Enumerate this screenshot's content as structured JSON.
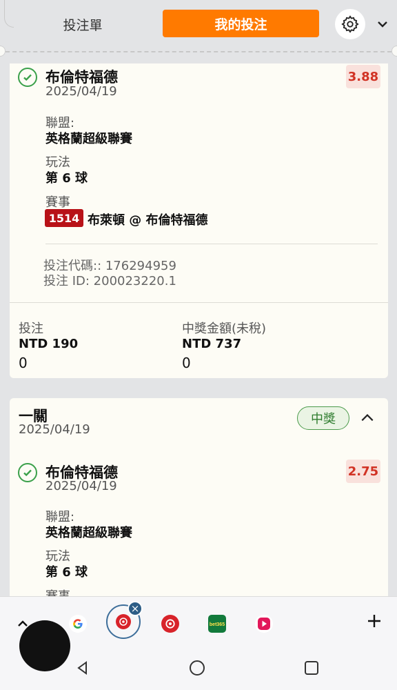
{
  "header": {
    "tab_betslip": "投注單",
    "tab_mybets": "我的投注"
  },
  "bet1": {
    "team": "布倫特福德",
    "date": "2025/04/19",
    "odds": "3.88",
    "league_label": "聯盟:",
    "league_value": "英格蘭超級聯賽",
    "market_label": "玩法",
    "market_value": "第 6 球",
    "event_label": "賽事",
    "event_number": "1514",
    "event_match": "布萊頓 @ 布倫特福德",
    "bet_code": "投注代碼:: 176294959",
    "bet_id": "投注 ID: 200023220.1",
    "stake_label": "投注",
    "stake_value": "NTD 190",
    "stake_sub": "0",
    "payout_label": "中獎金額(未稅)",
    "payout_value": "NTD 737",
    "payout_sub": "0"
  },
  "bet2": {
    "bet_type": "一關",
    "date": "2025/04/19",
    "status": "中獎",
    "team": "布倫特福德",
    "selection_date": "2025/04/19",
    "odds": "2.75",
    "league_label": "聯盟:",
    "league_value": "英格蘭超級聯賽",
    "market_label": "玩法",
    "market_value": "第 6 球",
    "event_label": "賽事"
  },
  "bottom_bar": {
    "apps": [
      "google-icon",
      "taiwan-lottery-icon",
      "taiwan-lottery-icon",
      "bet365-icon",
      "video-app-icon"
    ],
    "bet365_text": "bet365"
  },
  "colors": {
    "accent": "#ff7a00",
    "odds_text": "#d13224",
    "event_badge": "#b81218",
    "won_green": "#2f7d2f"
  }
}
